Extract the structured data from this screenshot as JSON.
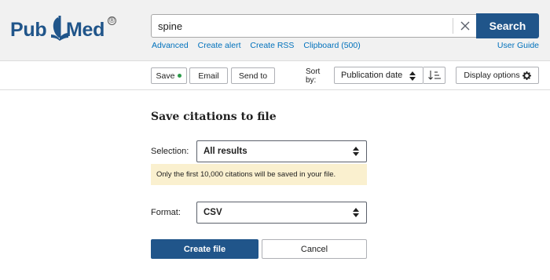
{
  "header": {
    "logo": {
      "part1": "Pub",
      "part2": "Med",
      "reg": "®"
    },
    "search": {
      "value": "spine",
      "placeholder": ""
    },
    "search_button": "Search",
    "links": [
      "Advanced",
      "Create alert",
      "Create RSS",
      "Clipboard (500)"
    ],
    "user_guide": "User Guide"
  },
  "toolbar": {
    "save_label": "Save",
    "email_label": "Email",
    "send_to_label": "Send to",
    "sort_by_label": "Sort by:",
    "sort_selected": "Publication date",
    "display_options_label": "Display options"
  },
  "save_panel": {
    "title": "Save citations to file",
    "selection_label": "Selection:",
    "selection_value": "All results",
    "notice": "Only the first 10,000 citations will be saved in your file.",
    "format_label": "Format:",
    "format_value": "CSV",
    "create_button": "Create file",
    "cancel_button": "Cancel"
  },
  "colors": {
    "brand_blue": "#20558a",
    "link_blue": "#0071bc",
    "notice_bg": "#faf0cf",
    "status_dot": "#2c9b4a"
  },
  "icons": [
    "clear-icon",
    "sort-order-icon",
    "gear-icon",
    "select-arrows-icon",
    "status-dot-icon"
  ]
}
